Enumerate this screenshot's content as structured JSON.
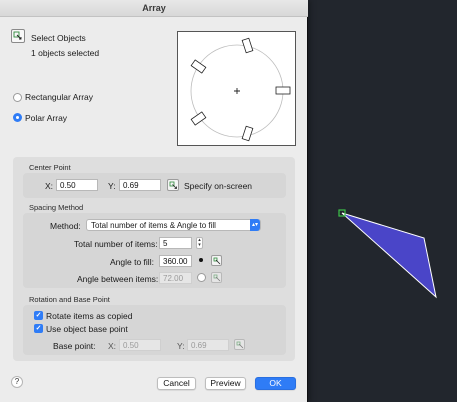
{
  "window": {
    "title": "Array"
  },
  "selection": {
    "label": "Select Objects",
    "status": "1 objects selected"
  },
  "array_type": {
    "rectangular_label": "Rectangular Array",
    "polar_label": "Polar Array",
    "selected": "polar"
  },
  "center_point": {
    "section_title": "Center Point",
    "x_label": "X:",
    "x_value": "0.50",
    "y_label": "Y:",
    "y_value": "0.69",
    "specify_label": "Specify on-screen"
  },
  "spacing": {
    "section_title": "Spacing Method",
    "method_label": "Method:",
    "method_value": "Total number of items & Angle to fill",
    "total_items_label": "Total number of items:",
    "total_items_value": "5",
    "angle_fill_label": "Angle to fill:",
    "angle_fill_value": "360.00",
    "angle_between_label": "Angle between items:",
    "angle_between_value": "72.00"
  },
  "rotation": {
    "section_title": "Rotation and Base Point",
    "rotate_label": "Rotate items as copied",
    "rotate_checked": true,
    "use_base_label": "Use object base point",
    "use_base_checked": true,
    "base_point_label": "Base point:",
    "x_label": "X:",
    "x_value": "0.50",
    "y_label": "Y:",
    "y_value": "0.69"
  },
  "buttons": {
    "help": "?",
    "cancel": "Cancel",
    "preview": "Preview",
    "ok": "OK"
  },
  "colors": {
    "accent": "#2f7cf6",
    "canvas_background": "#22262d",
    "shape_fill": "#4a45c8",
    "grip": "#3cc24a"
  }
}
